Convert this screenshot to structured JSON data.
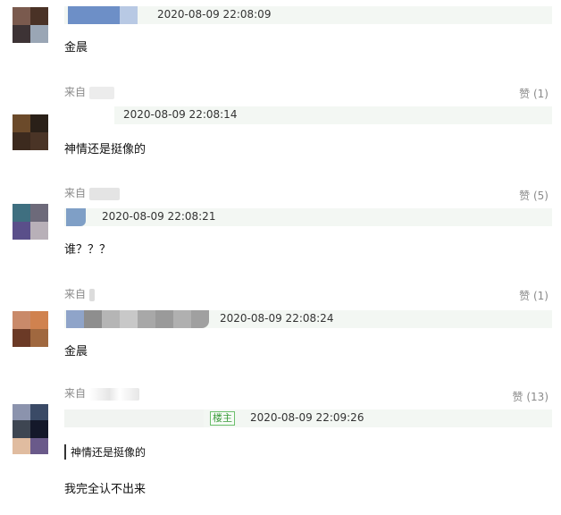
{
  "comments": [
    {
      "avatar_colors": [
        "#7a5a4e",
        "#4a3226",
        "#3d3335",
        "#9aa6b5"
      ],
      "name_blur_colors": [
        "#6d8fc7",
        "#b8c9e4"
      ],
      "timestamp": "2020-08-09 22:08:09",
      "text": "金晨",
      "from_label": "来自",
      "like_label": "赞 (1)"
    },
    {
      "avatar_colors": [
        "#6b4a2a",
        "#2a2018",
        "#3c2a1e",
        "#4a3426"
      ],
      "name_blur_colors": [
        "#e9ece9",
        "#f1f4f1"
      ],
      "timestamp": "2020-08-09 22:08:14",
      "text": "神情还是挺像的",
      "from_label": "来自",
      "like_label": "赞 (5)"
    },
    {
      "avatar_colors": [
        "#3f6f80",
        "#6d6a7a",
        "#5a4f8a",
        "#b8b0b8"
      ],
      "name_blur_colors": [
        "#7f9fc6"
      ],
      "timestamp": "2020-08-09 22:08:21",
      "text": "谁？？？",
      "from_label": "来自",
      "like_label": "赞 (1)"
    },
    {
      "avatar_colors": [
        "#c98a6a",
        "#d0824f",
        "#6b3a26",
        "#a0683f"
      ],
      "name_blur_colors": [
        "#8fa4c9",
        "#8e8e8e",
        "#b5b5b5",
        "#c8c8c8",
        "#a8a8a8",
        "#9a9a9a",
        "#b0b0b0",
        "#a0a0a0"
      ],
      "timestamp": "2020-08-09 22:08:24",
      "text": "金晨",
      "from_label": "来自",
      "like_label": "赞 (13)"
    },
    {
      "avatar_colors": [
        "#8b93ad",
        "#3a4a66",
        "#3e4652",
        "#14182a",
        "#e0bca0",
        "#6a5a8a"
      ],
      "name_blur_colors": [
        "#f1f4f1"
      ],
      "tag": "楼主",
      "timestamp": "2020-08-09 22:09:26",
      "quote": "神情还是挺像的",
      "text": "我完全认不出来"
    }
  ],
  "colors": {
    "meta_bar_bg": "#f3f7f3",
    "muted_text": "#8a8a8a",
    "tag_green": "#3a9a3a"
  }
}
